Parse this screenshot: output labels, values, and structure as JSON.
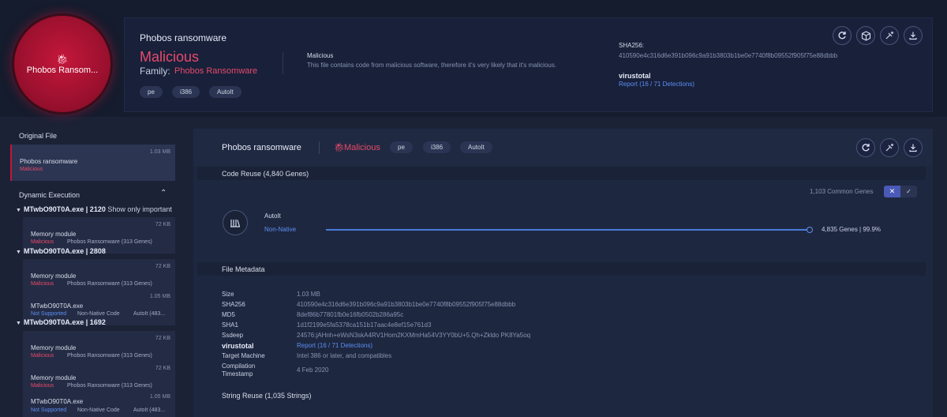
{
  "header": {
    "circle_name": "Phobos Ransom...",
    "title": "Phobos ransomware",
    "verdict": "Malicious",
    "family_label": "Family:",
    "family_value": "Phobos Ransomware",
    "tags": [
      "pe",
      "i386",
      "AutoIt"
    ],
    "desc_title": "Malicious",
    "desc": "This file contains code from malicious software, therefore it's very likely that it's malicious.",
    "sha_label": "SHA256:",
    "sha_value": "410590e4c316d6e391b096c9a91b3803b1be0e7740f8b09552f905f75e88dbbb",
    "vt_label": "virustotal",
    "vt_link": "Report (16 / 71 Detections)"
  },
  "sidebar": {
    "original_file_label": "Original File",
    "original": {
      "title": "Phobos ransomware",
      "status": "Malicious",
      "size": "1.03 MB"
    },
    "dynamic_label": "Dynamic Execution",
    "processes": [
      {
        "title": "MTwbO90T0A.exe | 2120",
        "extra": "Show only important",
        "cards": [
          {
            "title": "Memory module",
            "status": "Malicious",
            "info": "Phobos Ransomware (313 Genes)",
            "info2": "",
            "size": "72 KB"
          }
        ]
      },
      {
        "title": "MTwbO90T0A.exe | 2808",
        "extra": "",
        "cards": [
          {
            "title": "Memory module",
            "status": "Malicious",
            "info": "Phobos Ransomware (313 Genes)",
            "info2": "",
            "size": "72 KB"
          },
          {
            "title": "MTwbO90T0A.exe",
            "status": "Not Supported",
            "info": "Non-Native Code",
            "info2": "AutoIt (483...",
            "size": "1.05 MB"
          }
        ]
      },
      {
        "title": "MTwbO90T0A.exe | 1692",
        "extra": "",
        "cards": [
          {
            "title": "Memory module",
            "status": "Malicious",
            "info": "Phobos Ransomware (313 Genes)",
            "info2": "",
            "size": "72 KB"
          },
          {
            "title": "Memory module",
            "status": "Malicious",
            "info": "Phobos Ransomware (313 Genes)",
            "info2": "",
            "size": "72 KB"
          },
          {
            "title": "MTwbO90T0A.exe",
            "status": "Not Supported",
            "info": "Non-Native Code",
            "info2": "AutoIt (483...",
            "size": "1.05 MB"
          }
        ]
      }
    ]
  },
  "main": {
    "title": "Phobos ransomware",
    "verdict": "Malicious",
    "tags": [
      "pe",
      "i386",
      "AutoIt"
    ],
    "code_reuse_label": "Code Reuse (4,840 Genes)",
    "common_genes": "1,103 Common Genes",
    "toggle_x": "✕",
    "toggle_ok": "✓",
    "gene_name": "AutoIt",
    "gene_sub": "Non-Native",
    "gene_count": "4,835 Genes | 99.9%",
    "gene_fraction": 0.999,
    "metadata_label": "File Metadata",
    "metadata": [
      {
        "key": "Size",
        "value": "1.03 MB",
        "link": false,
        "bold": false
      },
      {
        "key": "SHA256",
        "value": "410590e4c316d6e391b096c9a91b3803b1be0e7740f8b09552f905f75e88dbbb",
        "link": false,
        "bold": false
      },
      {
        "key": "MD5",
        "value": "8def86b77801fb0e16fb0502b286a95c",
        "link": false,
        "bold": false
      },
      {
        "key": "SHA1",
        "value": "1d1f2199e5fa5378ca151b17aac4e8ef15e761d3",
        "link": false,
        "bold": false
      },
      {
        "key": "Ssdeep",
        "value": "24576:jAHnh+eWsN3skA4RV1Hom2KXMmHa54V3YY0bU+5.Qh+Zkldo PK8Ya5oq",
        "link": false,
        "bold": false
      },
      {
        "key": "virustotal",
        "value": "Report (16 / 71 Detections)",
        "link": true,
        "bold": true
      },
      {
        "key": "Target Machine",
        "value": "Intel 386 or later, and compatibles",
        "link": false,
        "bold": false
      },
      {
        "key": "Compilation Timestamp",
        "value": "4 Feb 2020",
        "link": false,
        "bold": false
      }
    ],
    "string_reuse_label": "String Reuse (1,035 Strings)"
  },
  "colors": {
    "malicious": "#e84a6a",
    "link": "#5b8ff2",
    "background": "#1b2236"
  },
  "icons": [
    "bug-icon",
    "reload-icon",
    "cube-icon",
    "syringe-icon",
    "download-icon",
    "chevron-up-icon",
    "library-icon"
  ]
}
